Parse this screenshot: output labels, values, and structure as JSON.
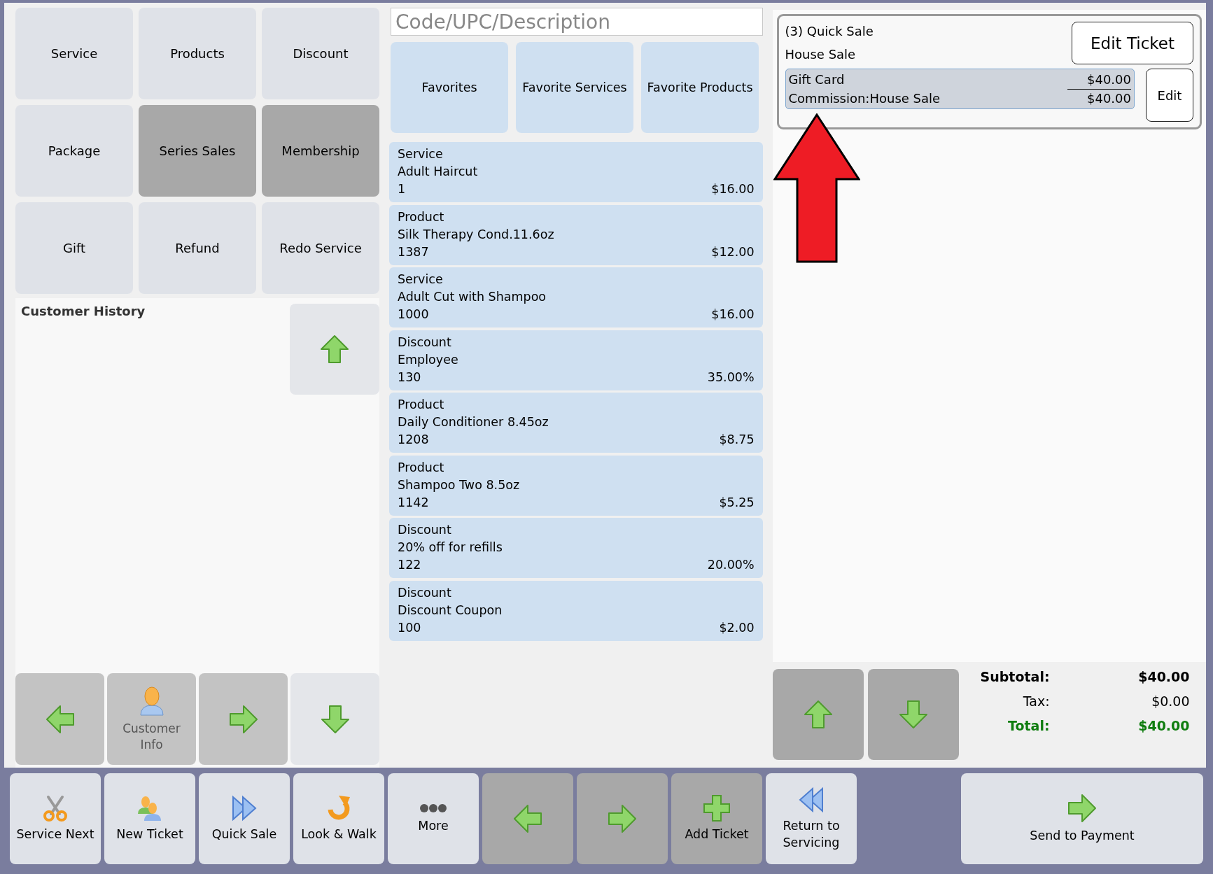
{
  "categories": [
    {
      "label": "Service",
      "disabled": false
    },
    {
      "label": "Products",
      "disabled": false
    },
    {
      "label": "Discount",
      "disabled": false
    },
    {
      "label": "Package",
      "disabled": false
    },
    {
      "label": "Series Sales",
      "disabled": true
    },
    {
      "label": "Membership",
      "disabled": true
    },
    {
      "label": "Gift",
      "disabled": false
    },
    {
      "label": "Refund",
      "disabled": false
    },
    {
      "label": "Redo Service",
      "disabled": false
    }
  ],
  "customer_history": {
    "title": "Customer History"
  },
  "history_nav": [
    {
      "kind": "left",
      "disabled": true
    },
    {
      "kind": "customer",
      "label": "Customer Info",
      "disabled": true
    },
    {
      "kind": "right",
      "disabled": true
    },
    {
      "kind": "down",
      "disabled": false
    }
  ],
  "search": {
    "placeholder": "Code/UPC/Description"
  },
  "favorites": [
    "Favorites",
    "Favorite Services",
    "Favorite Products"
  ],
  "items": [
    {
      "type": "Service",
      "name": "Adult Haircut",
      "code": "1",
      "price": "$16.00"
    },
    {
      "type": "Product",
      "name": "Silk Therapy Cond.11.6oz",
      "code": "1387",
      "price": "$12.00"
    },
    {
      "type": "Service",
      "name": "Adult Cut with Shampoo",
      "code": "1000",
      "price": "$16.00"
    },
    {
      "type": "Discount",
      "name": "Employee",
      "code": "130",
      "price": "35.00%"
    },
    {
      "type": "Product",
      "name": "Daily Conditioner 8.45oz",
      "code": "1208",
      "price": "$8.75"
    },
    {
      "type": "Product",
      "name": "Shampoo Two 8.5oz",
      "code": "1142",
      "price": "$5.25"
    },
    {
      "type": "Discount",
      "name": "20% off for refills",
      "code": "122",
      "price": "20.00%"
    },
    {
      "type": "Discount",
      "name": "Discount Coupon",
      "code": "100",
      "price": "$2.00"
    }
  ],
  "ticket": {
    "title": "(3) Quick Sale",
    "subtitle": "House Sale",
    "edit_ticket": "Edit Ticket",
    "edit": "Edit",
    "lines": [
      {
        "label": "Gift Card",
        "amount": "$40.00"
      },
      {
        "label": "Commission:House Sale",
        "amount": "$40.00"
      }
    ]
  },
  "ticket_nav": [
    {
      "kind": "up",
      "disabled": true
    },
    {
      "kind": "down",
      "disabled": true
    }
  ],
  "totals": [
    {
      "kind": "subtotal",
      "label": "Subtotal:",
      "value": "$40.00"
    },
    {
      "kind": "tax",
      "label": "Tax:",
      "value": "$0.00"
    },
    {
      "kind": "total",
      "label": "Total:",
      "value": "$40.00"
    }
  ],
  "toolbar": [
    {
      "kind": "scissors",
      "label": "Service Next",
      "disabled": false
    },
    {
      "kind": "people",
      "label": "New Ticket",
      "disabled": false
    },
    {
      "kind": "fast-forward",
      "label": "Quick Sale",
      "disabled": false
    },
    {
      "kind": "curved",
      "label": "Look & Walk",
      "disabled": false
    },
    {
      "kind": "dots",
      "label": "More",
      "disabled": false
    },
    {
      "kind": "left",
      "disabled": true
    },
    {
      "kind": "right",
      "disabled": true
    },
    {
      "kind": "plus",
      "label": "Add Ticket",
      "disabled": true
    },
    {
      "kind": "rewind",
      "label": "Return to Servicing",
      "disabled": false
    }
  ],
  "payment_button": {
    "label": "Send to Payment"
  }
}
